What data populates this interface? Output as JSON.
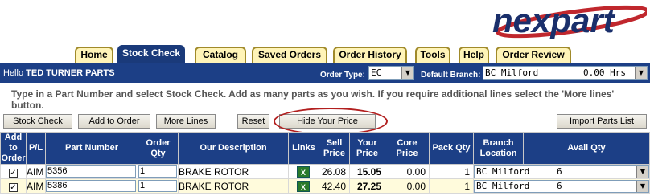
{
  "logo": {
    "text": "nexpart",
    "brand_color": "#1a2f6b",
    "accent_color": "#c0272d"
  },
  "tabs": [
    {
      "label": "Home",
      "active": false
    },
    {
      "label": "Stock Check",
      "active": true
    },
    {
      "label": "Catalog",
      "active": false
    },
    {
      "label": "Saved Orders",
      "active": false
    },
    {
      "label": "Order History",
      "active": false
    },
    {
      "label": "Tools",
      "active": false
    },
    {
      "label": "Help",
      "active": false
    },
    {
      "label": "Order Review",
      "active": false
    }
  ],
  "header": {
    "hello": "Hello",
    "user": "TED TURNER PARTS",
    "order_type_label": "Order Type:",
    "order_type_value": "EC",
    "branch_label": "Default Branch:",
    "branch_value": "BC Milford",
    "branch_hrs": "0.00 Hrs"
  },
  "instructions": "Type in a Part Number and select Stock Check. Add as many parts as you wish. If you require additional lines select the 'More lines' button.",
  "buttons": {
    "stock_check": "Stock Check",
    "add_to_order": "Add to Order",
    "more_lines": "More Lines",
    "reset": "Reset",
    "hide_price": "Hide Your Price",
    "import": "Import Parts List"
  },
  "columns": {
    "add": "Add to Order",
    "pl": "P/L",
    "part": "Part Number",
    "qty": "Order Qty",
    "desc": "Our Description",
    "links": "Links",
    "sell": "Sell Price",
    "your": "Your Price",
    "core": "Core Price",
    "pack": "Pack Qty",
    "branch": "Branch Location",
    "avail": "Avail Qty"
  },
  "rows": [
    {
      "checked": "✓",
      "pl": "AIM",
      "part": "5356",
      "qty": "1",
      "desc": "BRAKE ROTOR",
      "sell": "26.08",
      "your": "15.05",
      "core": "0.00",
      "pack": "1",
      "branch": "BC Milford",
      "avail": "6"
    },
    {
      "checked": "✓",
      "pl": "AIM",
      "part": "5386",
      "qty": "1",
      "desc": "BRAKE ROTOR",
      "sell": "42.40",
      "your": "27.25",
      "core": "0.00",
      "pack": "1",
      "branch": "BC Milford",
      "avail": "6"
    }
  ]
}
